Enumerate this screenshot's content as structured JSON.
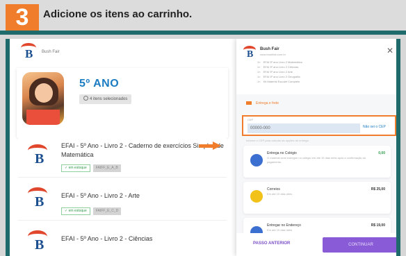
{
  "step": {
    "number": "3",
    "title": "Adicione os itens ao carrinho."
  },
  "left": {
    "brand": "Bush Fair",
    "grade": {
      "title": "5º ANO",
      "chip": "4 itens selecionados"
    },
    "books": [
      {
        "title": "EFAI - 5º Ano - Livro 2 - Caderno de exercícios Simples de Matemática",
        "tag": "em estoque",
        "code": "FAIFF_E_A_B"
      },
      {
        "title": "EFAI - 5º Ano - Livro 2 - Arte",
        "tag": "em estoque",
        "code": "FAIFF_E_C_D"
      },
      {
        "title": "EFAI - 5º Ano - Livro 2 - Ciências",
        "tag": "",
        "code": ""
      }
    ]
  },
  "right": {
    "store": "Bush Fair",
    "store_sub": "www.bushfair.com.br",
    "lines": [
      "EFAI 5º ano Livro 2 Matemática",
      "EFAI 5º ano Livro 2 Ciências",
      "EFAI 5º ano Livro 2 Arte",
      "EFAI 5º ano Livro 2 Geografia",
      "Kit Material Escolar Completo"
    ],
    "shipping_label": "Entrega e frete",
    "cep_label": "CEP",
    "cep_value": "00000-000",
    "cep_link": "Não sei o CEP",
    "note": "Informe o CEP para calcular as opções de entrega",
    "options": [
      {
        "title": "Entrega no Colégio",
        "sub": "O material será entregue no colégio em até 15 dias úteis após a confirmação do pagamento.",
        "price": "0,00",
        "color": "#3b6fd0"
      },
      {
        "title": "Correios",
        "sub": "Em até 10 dias úteis",
        "price": "R$ 25,00",
        "color": "#f2c21b"
      },
      {
        "title": "Entregar no Endereço",
        "sub": "Em até 10 dias úteis",
        "price": "R$ 19,00",
        "color": "#3b6fd0"
      }
    ],
    "back_label": "PASSO ANTERIOR",
    "next_label": "CONTINUAR"
  },
  "colors": {
    "accent": "#ef7d2b",
    "frame": "#1f6b6b",
    "brand_blue": "#1c7cc2",
    "purple": "#8a5bd6"
  }
}
